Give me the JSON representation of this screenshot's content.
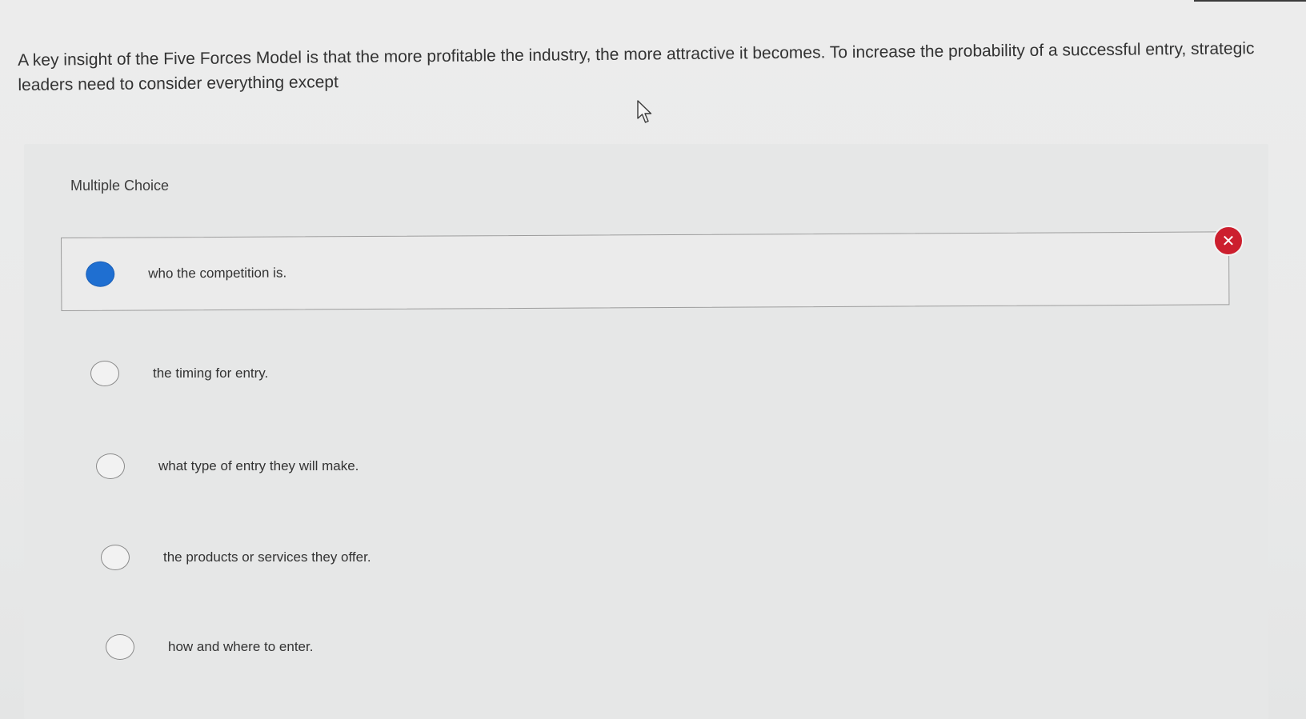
{
  "question": {
    "text": "A key insight of the Five Forces Model is that the more profitable the industry, the more attractive it becomes. To increase the probability of a successful entry, strategic leaders need to consider everything except"
  },
  "quiz": {
    "type_label": "Multiple Choice",
    "options": [
      {
        "label": "who the competition is.",
        "selected": true
      },
      {
        "label": "the timing for entry.",
        "selected": false
      },
      {
        "label": "what type of entry they will make.",
        "selected": false
      },
      {
        "label": "the products or services they offer.",
        "selected": false
      },
      {
        "label": "how and where to enter.",
        "selected": false
      }
    ],
    "result_icon": "incorrect-x-icon"
  },
  "colors": {
    "accent": "#1f6fd1",
    "error": "#cc1f2e"
  }
}
